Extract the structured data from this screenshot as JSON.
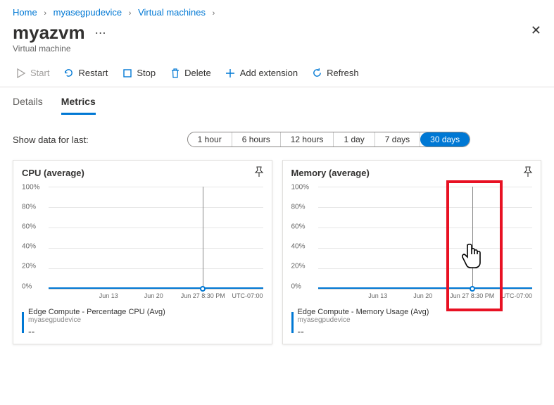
{
  "breadcrumb": {
    "items": [
      "Home",
      "myasegpudevice",
      "Virtual machines"
    ]
  },
  "header": {
    "title": "myazvm",
    "subtitle": "Virtual machine"
  },
  "toolbar": {
    "start": "Start",
    "restart": "Restart",
    "stop": "Stop",
    "delete": "Delete",
    "addExtension": "Add extension",
    "refresh": "Refresh"
  },
  "tabs": {
    "items": [
      "Details",
      "Metrics"
    ],
    "activeIndex": 1
  },
  "filter": {
    "label": "Show data for last:",
    "options": [
      "1 hour",
      "6 hours",
      "12 hours",
      "1 day",
      "7 days",
      "30 days"
    ],
    "activeIndex": 5
  },
  "cards": [
    {
      "title": "CPU (average)",
      "legend": {
        "name": "Edge Compute - Percentage CPU (Avg)",
        "sub": "myasegpudevice",
        "value": "--"
      }
    },
    {
      "title": "Memory (average)",
      "legend": {
        "name": "Edge Compute - Memory Usage (Avg)",
        "sub": "myasegpudevice",
        "value": "--"
      }
    }
  ],
  "chart_data": [
    {
      "type": "line",
      "title": "CPU (average)",
      "ylabel": "",
      "xlabel": "",
      "ylim": [
        0,
        100
      ],
      "yticks": [
        "100%",
        "80%",
        "60%",
        "40%",
        "20%",
        "0%"
      ],
      "xticks": [
        "Jun 13",
        "Jun 20",
        "Jun 27 8:30 PM"
      ],
      "timezone": "UTC-07:00",
      "series": [
        {
          "name": "Edge Compute - Percentage CPU (Avg)",
          "color": "#0078d4",
          "values": [
            0,
            0,
            0,
            0,
            0,
            0,
            0,
            0,
            0,
            0,
            0,
            0,
            0,
            0,
            0,
            0,
            0,
            0,
            0,
            0,
            0,
            0,
            0,
            0,
            0,
            0,
            0,
            0,
            0,
            0
          ]
        }
      ],
      "highlight_x": "Jun 27 8:30 PM"
    },
    {
      "type": "line",
      "title": "Memory (average)",
      "ylabel": "",
      "xlabel": "",
      "ylim": [
        0,
        100
      ],
      "yticks": [
        "100%",
        "80%",
        "60%",
        "40%",
        "20%",
        "0%"
      ],
      "xticks": [
        "Jun 13",
        "Jun 20",
        "Jun 27 8:30 PM"
      ],
      "timezone": "UTC-07:00",
      "series": [
        {
          "name": "Edge Compute - Memory Usage (Avg)",
          "color": "#0078d4",
          "values": [
            0,
            0,
            0,
            0,
            0,
            0,
            0,
            0,
            0,
            0,
            0,
            0,
            0,
            0,
            0,
            0,
            0,
            0,
            0,
            0,
            0,
            0,
            0,
            0,
            0,
            0,
            0,
            0,
            0,
            0
          ]
        }
      ],
      "highlight_x": "Jun 27 8:30 PM"
    }
  ]
}
